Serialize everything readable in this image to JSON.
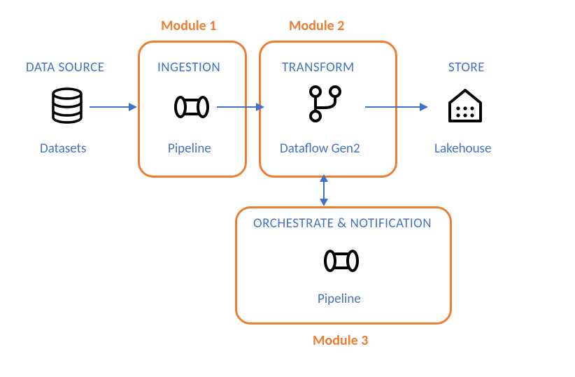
{
  "modules": {
    "m1": "Module 1",
    "m2": "Module 2",
    "m3": "Module 3"
  },
  "stages": {
    "data_source": {
      "header": "DATA SOURCE",
      "label": "Datasets"
    },
    "ingestion": {
      "header": "INGESTION",
      "label": "Pipeline"
    },
    "transform": {
      "header": "TRANSFORM",
      "label": "Dataflow Gen2"
    },
    "store": {
      "header": "STORE",
      "label": "Lakehouse"
    },
    "orchestrate": {
      "header": "ORCHESTRATE & NOTIFICATION",
      "label": "Pipeline"
    }
  }
}
